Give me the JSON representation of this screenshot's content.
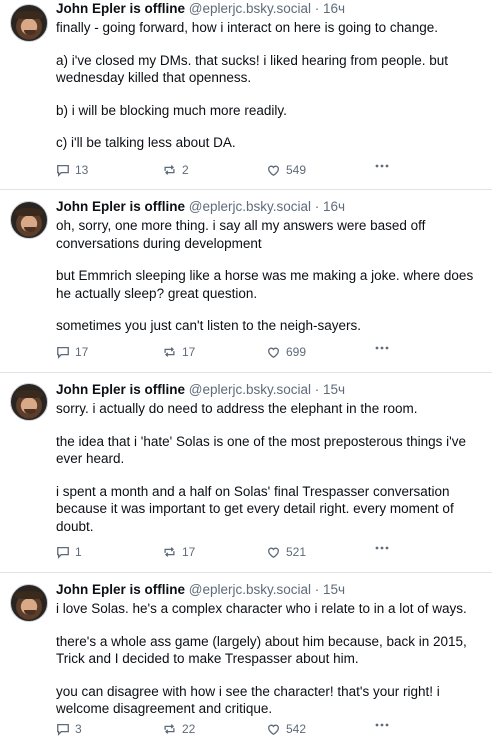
{
  "posts": [
    {
      "author": "John Epler is offline",
      "handle": "@eplerjc.bsky.social",
      "time": "16ч",
      "paragraphs": [
        "finally - going forward, how i interact on here is going to change.",
        "a) i've closed my DMs. that sucks! i liked hearing from people. but wednesday killed that openness.",
        "b) i will be blocking much more readily.",
        "c) i'll be talking less about DA."
      ],
      "replies": "13",
      "reposts": "2",
      "likes": "549"
    },
    {
      "author": "John Epler is offline",
      "handle": "@eplerjc.bsky.social",
      "time": "16ч",
      "paragraphs": [
        "oh, sorry, one more thing. i say all my answers were based off conversations during development",
        "but Emmrich sleeping like a horse was me making a joke. where does he actually sleep? great question.",
        "sometimes you just can't listen to the neigh-sayers."
      ],
      "replies": "17",
      "reposts": "17",
      "likes": "699"
    },
    {
      "author": "John Epler is offline",
      "handle": "@eplerjc.bsky.social",
      "time": "15ч",
      "paragraphs": [
        "sorry. i actually do need to address the elephant in the room.",
        "the idea that i 'hate' Solas is one of the most preposterous things i've ever heard.",
        "i spent a month and a half on Solas' final Trespasser conversation because it was important to get every detail right. every moment of doubt."
      ],
      "replies": "1",
      "reposts": "17",
      "likes": "521"
    },
    {
      "author": "John Epler is offline",
      "handle": "@eplerjc.bsky.social",
      "time": "15ч",
      "paragraphs": [
        "i love Solas. he's a complex character who i relate to in a lot of ways.",
        "there's a whole ass game (largely) about him because, back in 2015, Trick and I decided to make Trespasser about him.",
        "you can disagree with how i see the character! that's your right! i welcome disagreement and critique."
      ],
      "replies": "3",
      "reposts": "22",
      "likes": "542"
    }
  ],
  "icons": {
    "reply": "speech-bubble-icon",
    "repost": "repost-arrows-icon",
    "like": "heart-icon",
    "more": "ellipsis-icon"
  },
  "colors": {
    "text": "#0b0f14",
    "muted": "#5f6b7a",
    "divider": "#dfe4ea"
  }
}
